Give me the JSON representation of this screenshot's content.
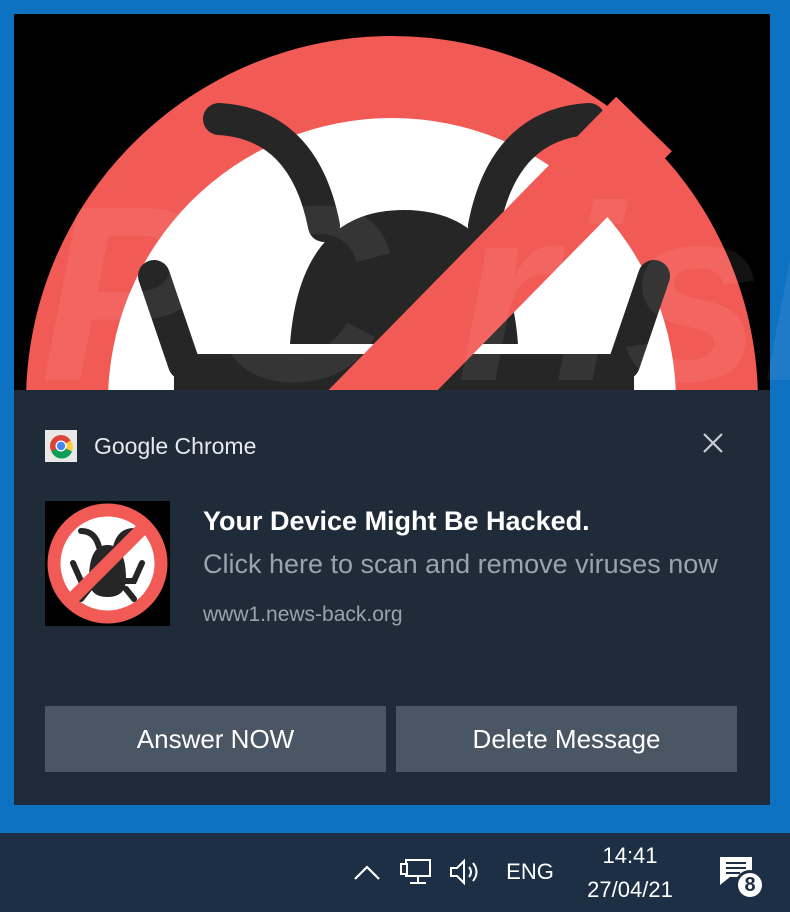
{
  "notification": {
    "app_name": "Google Chrome",
    "app_icon": "chrome-logo-icon",
    "hero_image": "no-bugs-sign",
    "content_icon": "no-bugs-sign",
    "title": "Your Device Might Be Hacked.",
    "body": "Click here to scan and remove viruses now",
    "source": "www1.news-back.org",
    "close_icon": "close-icon",
    "buttons": {
      "primary": "Answer NOW",
      "secondary": "Delete Message"
    }
  },
  "watermark": {
    "text": "PC risk.com"
  },
  "taskbar": {
    "show_hidden_icon": "chevron-up-icon",
    "network_icon": "network-icon",
    "volume_icon": "volume-icon",
    "language": "ENG",
    "time": "14:41",
    "date": "27/04/21",
    "action_center_icon": "action-center-icon",
    "notification_count": "8"
  },
  "colors": {
    "accent_blue": "#0e72c3",
    "toast_bg": "#1f2b38",
    "button_bg": "#4a5663",
    "taskbar_bg": "#1c2f44",
    "sign_red": "#f15a55"
  }
}
